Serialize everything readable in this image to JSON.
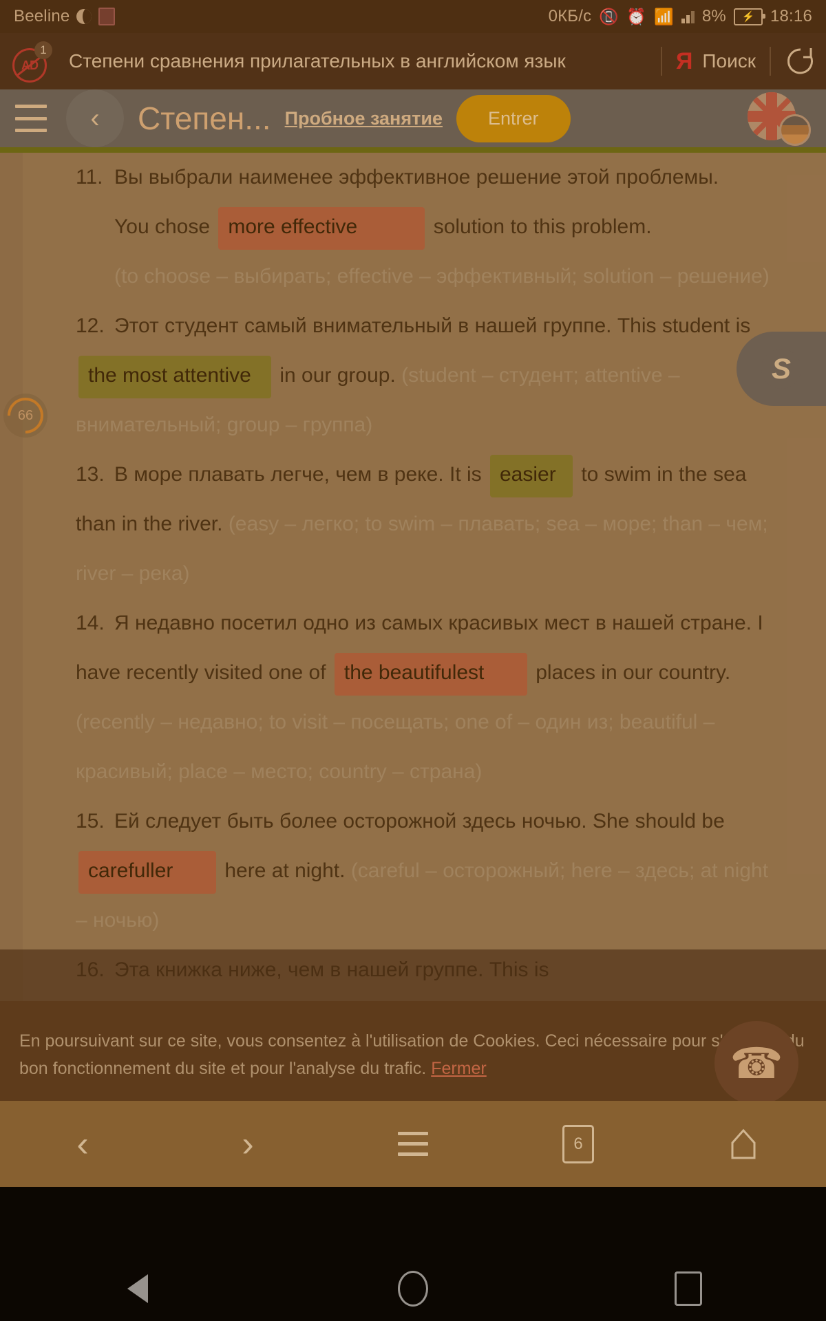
{
  "status_bar": {
    "carrier": "Beeline",
    "data_rate": "0КБ/с",
    "battery_percent": "8%",
    "time": "18:16",
    "icons": [
      "moon-icon",
      "image-icon",
      "vibrate-icon",
      "alarm-icon",
      "wifi-icon",
      "signal-bars-icon",
      "battery-charging-icon"
    ]
  },
  "browser_titlebar": {
    "adblock_badge": "1",
    "page_title": "Степени сравнения прилагательных в английском язык",
    "yandex_logo": "Я",
    "search_label": "Поиск",
    "reload_icon": "reload-icon"
  },
  "site_header": {
    "menu_icon": "hamburger-icon",
    "back_icon": "chevron-left-icon",
    "brand": "Степен...",
    "trial_link": "Пробное занятие",
    "login_button": "Entrer",
    "flags": [
      "uk-flag-icon",
      "secondary-flag-icon"
    ]
  },
  "progress_bubble": {
    "value": "66"
  },
  "skype_widget": {
    "label": "S",
    "icon": "skype-icon"
  },
  "call_widget": {
    "icon": "phone-icon"
  },
  "exercises": [
    {
      "num": "11.",
      "ru": "Вы выбрали наименее эффективное решение этой проблемы.",
      "en_before": "You chose",
      "answer": "more effective",
      "answer_state": "wrong",
      "en_after": "solution to this problem.",
      "hint": "(to choose – выбирать; effective – эффективный; solution – реше­ние)"
    },
    {
      "num": "12.",
      "ru": "Этот студент самый внимательный в нашей группе.",
      "en_before": "This student is",
      "answer": "the most attentive",
      "answer_state": "right",
      "en_after": "in our group.",
      "hint": "(student – студент; attentive – внимательный; group – группа)"
    },
    {
      "num": "13.",
      "ru": "В море плавать легче, чем в реке.",
      "en_before": "It is",
      "answer": "easier",
      "answer_state": "right",
      "en_after": "to swim in the sea than in the river.",
      "hint": "(easy – легко; to swim – плавать; sea – море; than – чем; river – река)"
    },
    {
      "num": "14.",
      "ru": "Я недавно посетил одно из самых красивых мест в нашей стране.",
      "en_before": "I have recently visited one of",
      "answer": "the beautifulest",
      "answer_state": "wrong",
      "en_after": "places in our country.",
      "hint": "(recently – недавно; to visit – посещать; one of – один из; beautiful – красивый; place – место; country – стра­на)"
    },
    {
      "num": "15.",
      "ru": "Ей следует быть более осторожной здесь ночью.",
      "en_before": "She should be",
      "answer": "carefuller",
      "answer_state": "wrong",
      "en_after": "here at night.",
      "hint": "(careful – осторожный; here – здесь; at night – ночью)"
    },
    {
      "num": "16.",
      "ru": "Эта книжка ниже, чем в нашей группе.",
      "en_before": "This is",
      "answer": "",
      "answer_state": "",
      "en_after": "",
      "hint": ""
    }
  ],
  "cookie_banner": {
    "text": "En poursuivant sur ce site, vous consentez à l'utilisation de Cookies. Ceci nécessaire pour s'assurer du bon fonctionnement du site et pour l'analyse du trafic.",
    "close_label": "Fermer"
  },
  "browser_navbar": {
    "back_icon": "chevron-left-icon",
    "forward_icon": "chevron-right-icon",
    "menu_icon": "list-menu-icon",
    "tab_count": "6",
    "home_icon": "home-icon"
  },
  "android_nav": {
    "back_icon": "android-back-icon",
    "home_icon": "android-home-icon",
    "recents_icon": "android-recents-icon"
  },
  "colors": {
    "page_bg": "#96754f",
    "header_grey": "#6b6156",
    "accent_olive": "#6d6a14",
    "login_amber": "#c68a09",
    "wrong_answer": "#b0603d",
    "right_answer": "#85772a",
    "hint_text": "#a58a66",
    "body_text": "#4b3213",
    "cookie_bg": "#5c3a1c",
    "navbar_bg": "#8a6434"
  }
}
